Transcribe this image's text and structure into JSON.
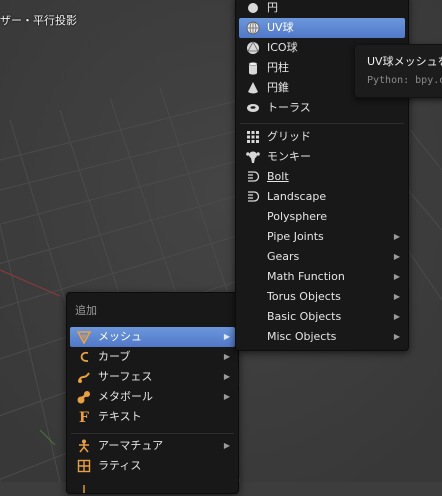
{
  "viewport": {
    "title": "ザー・平行投影"
  },
  "add_menu": {
    "header": "追加",
    "items": [
      {
        "label": "メッシュ",
        "icon": "mesh-icon",
        "active": true,
        "submenu": true
      },
      {
        "label": "カーブ",
        "icon": "curve-icon",
        "submenu": true
      },
      {
        "label": "サーフェス",
        "icon": "surface-icon",
        "submenu": true
      },
      {
        "label": "メタボール",
        "icon": "metaball-icon",
        "submenu": true
      },
      {
        "label": "テキスト",
        "icon": "text-icon",
        "submenu": false
      },
      {
        "label": "アーマチュア",
        "icon": "armature-icon",
        "submenu": true
      },
      {
        "label": "ラティス",
        "icon": "lattice-icon",
        "submenu": false
      }
    ]
  },
  "mesh_menu": {
    "items": [
      {
        "label": "円",
        "icon": "circle-icon"
      },
      {
        "label": "UV球",
        "icon": "uv-sphere-icon",
        "active": true
      },
      {
        "label": "ICO球",
        "icon": "ico-sphere-icon"
      },
      {
        "label": "円柱",
        "icon": "cylinder-icon"
      },
      {
        "label": "円錐",
        "icon": "cone-icon"
      },
      {
        "label": "トーラス",
        "icon": "torus-icon"
      },
      {
        "label": "グリッド",
        "icon": "grid-icon"
      },
      {
        "label": "モンキー",
        "icon": "monkey-icon"
      },
      {
        "label": "Bolt",
        "icon": "bolt-icon"
      },
      {
        "label": "Landscape",
        "icon": "landscape-icon"
      },
      {
        "label": "Polysphere"
      },
      {
        "label": "Pipe Joints",
        "submenu": true
      },
      {
        "label": "Gears",
        "submenu": true
      },
      {
        "label": "Math Function",
        "submenu": true
      },
      {
        "label": "Torus Objects",
        "submenu": true
      },
      {
        "label": "Basic Objects",
        "submenu": true
      },
      {
        "label": "Misc Objects",
        "submenu": true
      }
    ]
  },
  "tooltip": {
    "title": "UV球メッシュを",
    "python": "Python: bpy.o"
  },
  "colors": {
    "highlight": "#5680d0",
    "menu_bg": "#181818",
    "viewport_bg": "#3d3d3d",
    "grid_line": "#4a4a4a",
    "axis_red": "#8a3a3a",
    "icon_orange": "#e8a040"
  }
}
